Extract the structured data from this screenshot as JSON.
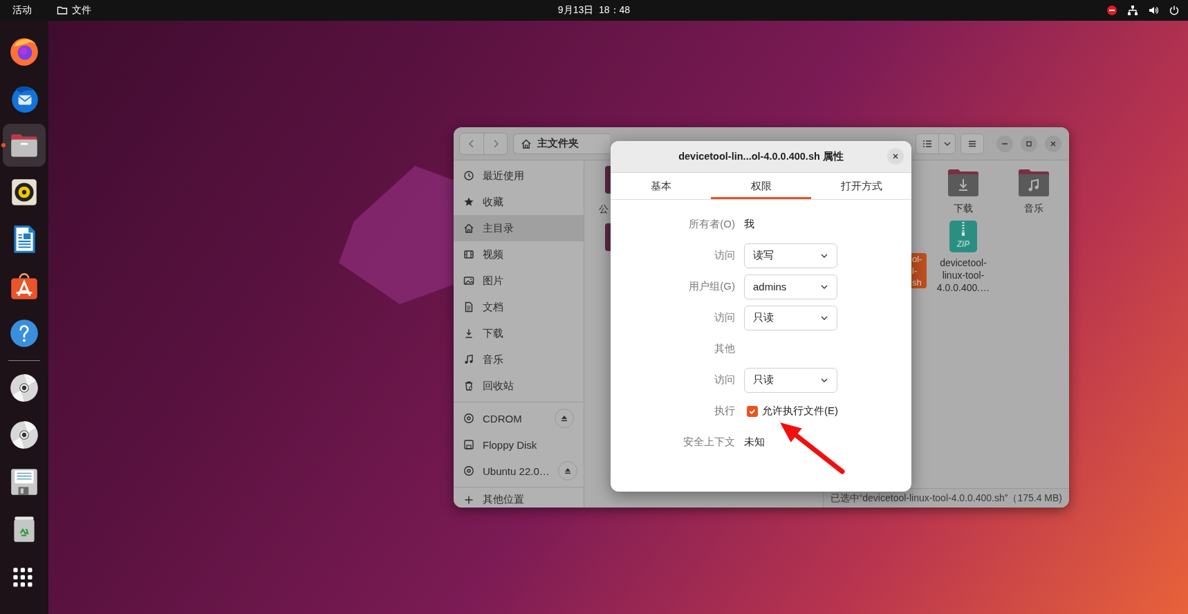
{
  "top_bar": {
    "activities": "活动",
    "app_menu": "文件",
    "clock": "9月13日  18：48",
    "status_icons": [
      {
        "kind": "no-entry"
      },
      {
        "kind": "network"
      },
      {
        "kind": "volume"
      },
      {
        "kind": "power"
      }
    ]
  },
  "dock": {
    "apps": [
      {
        "kind": "browser",
        "running": false,
        "selected": false
      },
      {
        "kind": "mail",
        "running": false,
        "selected": false
      },
      {
        "kind": "files",
        "running": true,
        "selected": true
      },
      {
        "kind": "music-player",
        "running": false,
        "selected": false
      },
      {
        "kind": "writer",
        "running": false,
        "selected": false
      },
      {
        "kind": "software",
        "running": false,
        "selected": false
      },
      {
        "kind": "help",
        "running": false,
        "selected": false
      }
    ],
    "mounts": [
      {
        "kind": "disc",
        "running": false,
        "selected": false
      },
      {
        "kind": "disc",
        "running": false,
        "selected": false
      },
      {
        "kind": "floppy",
        "running": false,
        "selected": false
      },
      {
        "kind": "trash",
        "running": false,
        "selected": false
      }
    ]
  },
  "file_manager": {
    "path": "主文件夹",
    "sidebar": {
      "places": [
        {
          "kind": "clock",
          "label": "最近使用",
          "selected": false
        },
        {
          "kind": "star",
          "label": "收藏",
          "selected": false
        },
        {
          "kind": "home",
          "label": "主目录",
          "selected": true
        },
        {
          "kind": "film",
          "label": "视频",
          "selected": false
        },
        {
          "kind": "image",
          "label": "图片",
          "selected": false
        },
        {
          "kind": "document",
          "label": "文档",
          "selected": false
        },
        {
          "kind": "download",
          "label": "下载",
          "selected": false
        },
        {
          "kind": "music",
          "label": "音乐",
          "selected": false
        },
        {
          "kind": "trash",
          "label": "回收站",
          "selected": false
        }
      ],
      "devices": [
        {
          "kind": "disc",
          "label": "CDROM",
          "eject": true
        },
        {
          "kind": "floppy",
          "label": "Floppy Disk",
          "eject": false
        },
        {
          "kind": "disc",
          "label": "Ubuntu 22.0…",
          "eject": true
        }
      ],
      "other": {
        "kind": "plus",
        "label": "其他位置"
      }
    },
    "content": {
      "left_edge": [
        {
          "kind": "folder",
          "label": "公"
        },
        {
          "kind": "folder"
        }
      ],
      "selected_file": {
        "label_lines": [
          "ol-",
          "l-",
          "sh"
        ],
        "selected": true
      },
      "grid": [
        {
          "kind": "folder-download",
          "label_lines": [
            "下载"
          ]
        },
        {
          "kind": "folder-music",
          "label_lines": [
            "音乐"
          ]
        },
        {
          "kind": "zip",
          "icon_text": "ZiP",
          "label_lines": [
            "devicetool-",
            "linux-tool-",
            "4.0.0.400.…"
          ]
        }
      ]
    },
    "status": "已选中“devicetool-linux-tool-4.0.0.400.sh”（175.4 MB)"
  },
  "dialog": {
    "title": "devicetool-lin...ol-4.0.0.400.sh 属性",
    "tabs": [
      {
        "label": "基本",
        "selected": false
      },
      {
        "label": "权限",
        "selected": true
      },
      {
        "label": "打开方式",
        "selected": false
      }
    ],
    "rows": [
      {
        "kind": "text",
        "label": "所有者(O)",
        "value": "我"
      },
      {
        "kind": "dropdown",
        "label": "访问",
        "value": "读写"
      },
      {
        "kind": "dropdown",
        "label": "用户组(G)",
        "value": "admins"
      },
      {
        "kind": "dropdown",
        "label": "访问",
        "value": "只读"
      },
      {
        "kind": "heading",
        "label": "其他"
      },
      {
        "kind": "dropdown",
        "label": "访问",
        "value": "只读"
      },
      {
        "kind": "checkbox",
        "label": "执行",
        "value": "允许执行文件(E)",
        "checked": true
      },
      {
        "kind": "text",
        "label": "安全上下文",
        "value": "未知"
      }
    ]
  }
}
